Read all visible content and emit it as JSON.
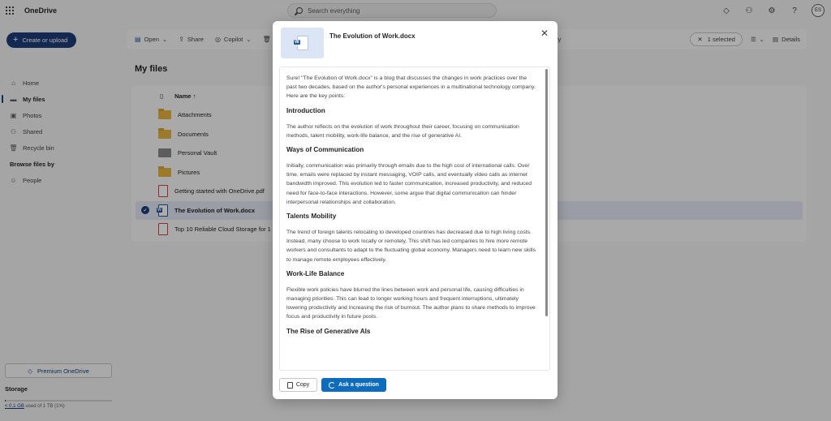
{
  "app": {
    "brand": "OneDrive",
    "search_placeholder": "Search everything",
    "avatar_initials": "ES"
  },
  "sidebar": {
    "create_label": "Create or upload",
    "items": [
      {
        "label": "Home",
        "icon": "home-icon"
      },
      {
        "label": "My files",
        "icon": "folder-icon",
        "active": true
      },
      {
        "label": "Photos",
        "icon": "photos-icon"
      },
      {
        "label": "Shared",
        "icon": "people-icon"
      },
      {
        "label": "Recycle bin",
        "icon": "trash-icon"
      }
    ],
    "browse_heading": "Browse files by",
    "people_label": "People",
    "premium_label": "Premium OneDrive",
    "storage_label": "Storage",
    "storage_used": "< 0.1 GB",
    "storage_rest": " used of 1 TB (1%)",
    "storage_fraction": 0.01
  },
  "commandbar": {
    "open": "Open",
    "share": "Share",
    "copilot": "Copilot",
    "selected": "1 selected",
    "details": "Details",
    "peek": "ry"
  },
  "main": {
    "title": "My files",
    "name_header": "Name ↑",
    "rows": [
      {
        "name": "Attachments",
        "type": "folder"
      },
      {
        "name": "Documents",
        "type": "folder"
      },
      {
        "name": "Personal Vault",
        "type": "vault"
      },
      {
        "name": "Pictures",
        "type": "folder"
      },
      {
        "name": "Getting started with OneDrive.pdf",
        "type": "pdf"
      },
      {
        "name": "The Evolution of Work.docx",
        "type": "word",
        "selected": true
      },
      {
        "name": "Top 10 Reliable Cloud Storage for 1",
        "type": "pdf"
      }
    ]
  },
  "dialog": {
    "title": "The Evolution of Work.docx",
    "intro": "Sure! \"The Evolution of Work.docx\" is a blog that discusses the changes in work practices over the past two decades, based on the author's personal experiences in a multinational technology company. Here are the key points:",
    "sections": [
      {
        "heading": "Introduction",
        "text": "The author reflects on the evolution of work throughout their career, focusing on communication methods, talent mobility, work-life balance, and the rise of generative AI."
      },
      {
        "heading": "Ways of Communication",
        "text": "Initially, communication was primarily through emails due to the high cost of international calls. Over time, emails were replaced by instant messaging, VOIP calls, and eventually video calls as internet bandwidth improved. This evolution led to faster communication, increased productivity, and reduced need for face-to-face interactions. However, some argue that digital communication can hinder interpersonal relationships and collaboration."
      },
      {
        "heading": "Talents Mobility",
        "text": "The trend of foreign talents relocating to developed countries has decreased due to high living costs. Instead, many choose to work locally or remotely. This shift has led companies to hire more remote workers and consultants to adapt to the fluctuating global economy. Managers need to learn new skills to manage remote employees effectively."
      },
      {
        "heading": "Work-Life Balance",
        "text": "Flexible work policies have blurred the lines between work and personal life, causing difficulties in managing priorities. This can lead to longer working hours and frequent interruptions, ultimately lowering productivity and increasing the risk of burnout. The author plans to share methods to improve focus and productivity in future posts."
      },
      {
        "heading": "The Rise of Generative AIs",
        "text": ""
      }
    ],
    "copy_label": "Copy",
    "ask_label": "Ask a question"
  }
}
